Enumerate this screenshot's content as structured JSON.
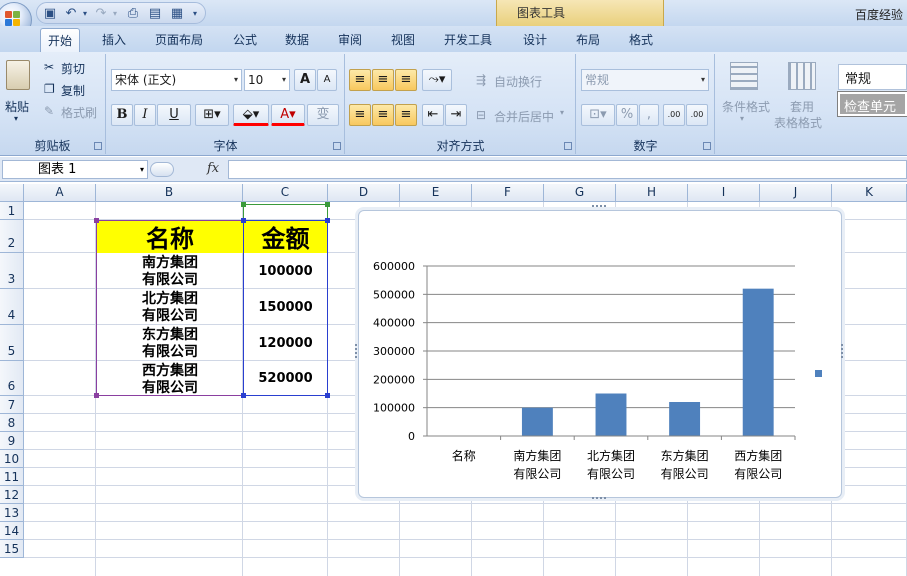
{
  "titlebar": {
    "context_tool": "图表工具",
    "app_title": "百度经验"
  },
  "tabs": [
    "开始",
    "插入",
    "页面布局",
    "公式",
    "数据",
    "审阅",
    "视图",
    "开发工具",
    "设计",
    "布局",
    "格式"
  ],
  "ribbon": {
    "clipboard": {
      "paste": "粘贴",
      "cut": "剪切",
      "copy": "复制",
      "format_painter": "格式刷",
      "label": "剪贴板"
    },
    "font": {
      "name": "宋体 (正文)",
      "size": "10",
      "label": "字体",
      "bold": "B",
      "italic": "I",
      "underline": "U",
      "grow": "A",
      "shrink": "A",
      "wen": "变"
    },
    "alignment": {
      "wrap": "自动换行",
      "merge": "合并后居中",
      "label": "对齐方式"
    },
    "number": {
      "format": "常规",
      "percent": "%",
      "comma": ",",
      "inc_decimal": ".00",
      "dec_decimal": ".00",
      "label": "数字"
    },
    "styles": {
      "conditional": "条件格式",
      "table_format_1": "套用",
      "table_format_2": "表格格式",
      "style_normal": "常规",
      "style_check": "检查单元"
    }
  },
  "formula_bar": {
    "name_box": "图表 1",
    "fx": "fx",
    "formula": ""
  },
  "columns": [
    "A",
    "B",
    "C",
    "D",
    "E",
    "F",
    "G",
    "H",
    "I",
    "J",
    "K"
  ],
  "rows": [
    "1",
    "2",
    "3",
    "4",
    "5",
    "6",
    "7",
    "8",
    "9",
    "10",
    "11",
    "12",
    "13",
    "14",
    "15"
  ],
  "table": {
    "header_name": "名称",
    "header_amount": "金额",
    "rows": [
      {
        "name1": "南方集团",
        "name2": "有限公司",
        "amount": "100000"
      },
      {
        "name1": "北方集团",
        "name2": "有限公司",
        "amount": "150000"
      },
      {
        "name1": "东方集团",
        "name2": "有限公司",
        "amount": "120000"
      },
      {
        "name1": "西方集团",
        "name2": "有限公司",
        "amount": "520000"
      }
    ]
  },
  "chart_data": {
    "type": "bar",
    "categories": [
      "名称",
      "南方集团 有限公司",
      "北方集团 有限公司",
      "东方集团 有限公司",
      "西方集团 有限公司"
    ],
    "category_lines": [
      [
        "名称"
      ],
      [
        "南方集团",
        "有限公司"
      ],
      [
        "北方集团",
        "有限公司"
      ],
      [
        "东方集团",
        "有限公司"
      ],
      [
        "西方集团",
        "有限公司"
      ]
    ],
    "values": [
      0,
      100000,
      150000,
      120000,
      520000
    ],
    "yticks": [
      "0",
      "100000",
      "200000",
      "300000",
      "400000",
      "500000",
      "600000"
    ],
    "ylim": [
      0,
      600000
    ],
    "title": "",
    "xlabel": "",
    "ylabel": "",
    "grid": true,
    "bar_color": "#4f81bd",
    "legend": "right"
  },
  "colors": {
    "header_fill": "#ffff00",
    "bar": "#4f81bd",
    "ribbon": "#d5e3f5"
  }
}
